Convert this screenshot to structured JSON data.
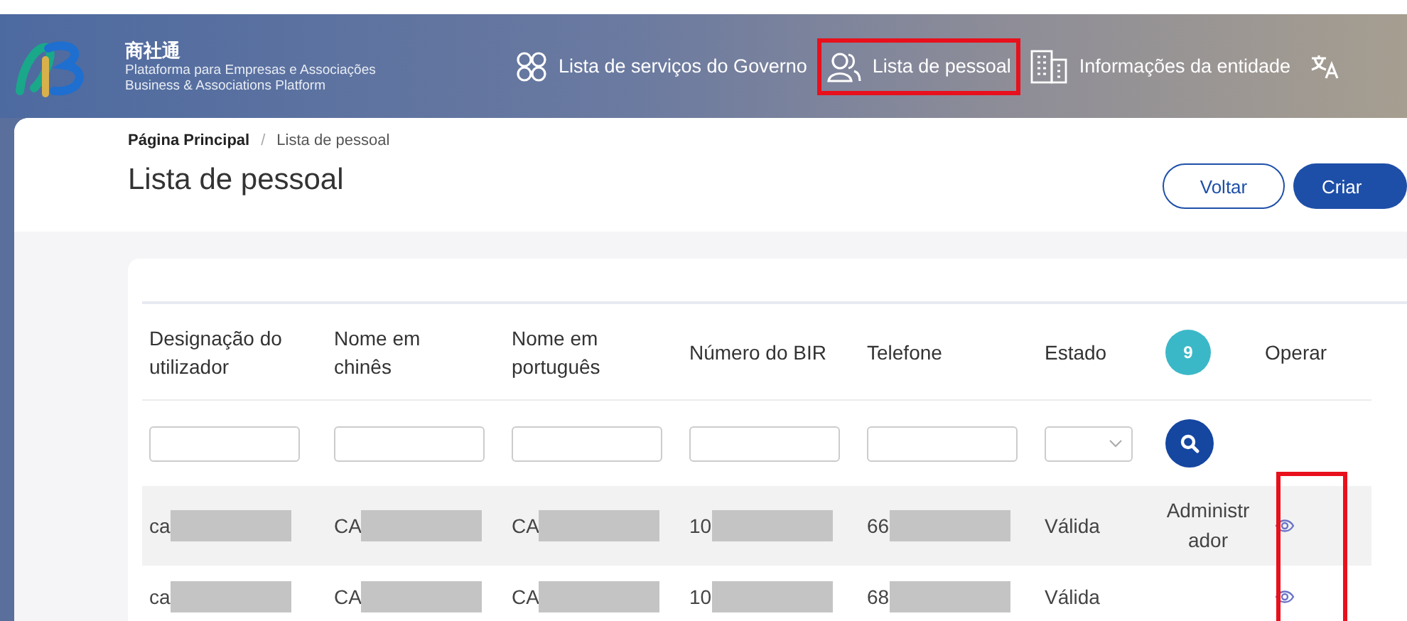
{
  "brand": {
    "name": "商社通",
    "subtitle_pt": "Plataforma para Empresas e Associações",
    "subtitle_en": "Business & Associations Platform"
  },
  "nav": [
    {
      "kind": "services",
      "label": "Lista de serviços do Governo",
      "highlighted": false
    },
    {
      "kind": "people",
      "label": "Lista de pessoal",
      "highlighted": true
    },
    {
      "kind": "building",
      "label": "Informações da entidade",
      "highlighted": false
    },
    {
      "kind": "language",
      "highlighted": false
    }
  ],
  "breadcrumb": [
    {
      "label": "Página Principal",
      "current": false
    },
    {
      "label": "Lista de pessoal",
      "current": true
    }
  ],
  "breadcrumb_separator": "/",
  "page_title": "Lista de pessoal",
  "buttons": [
    {
      "kind": "outline",
      "label": "Voltar"
    },
    {
      "kind": "primary",
      "label": "Criar"
    }
  ],
  "table": {
    "columns": [
      {
        "kind": "text",
        "label": "Designação do utilizador"
      },
      {
        "kind": "text",
        "label": "Nome em chinês"
      },
      {
        "kind": "text",
        "label": "Nome em português"
      },
      {
        "kind": "text",
        "label": "Número do BIR"
      },
      {
        "kind": "text",
        "label": "Telefone"
      },
      {
        "kind": "text",
        "label": "Estado"
      },
      {
        "kind": "count",
        "label": "9"
      },
      {
        "kind": "action",
        "label": "Operar"
      }
    ],
    "filters": [
      {
        "kind": "input"
      },
      {
        "kind": "input"
      },
      {
        "kind": "input"
      },
      {
        "kind": "input"
      },
      {
        "kind": "input"
      },
      {
        "kind": "select"
      },
      {
        "kind": "search"
      },
      {
        "kind": "none"
      }
    ],
    "action_highlighted": true,
    "rows": [
      {
        "cells": [
          {
            "text": "ca",
            "redacted": true
          },
          {
            "text": "CA",
            "redacted": true
          },
          {
            "text": "CA",
            "redacted": true
          },
          {
            "text": "10",
            "redacted": true
          },
          {
            "text": "66",
            "redacted": true
          },
          {
            "text": "Válida",
            "redacted": false
          },
          {
            "text": "Administrador",
            "redacted": false
          }
        ]
      },
      {
        "cells": [
          {
            "text": "ca",
            "redacted": true
          },
          {
            "text": "CA",
            "redacted": true
          },
          {
            "text": "CA",
            "redacted": true
          },
          {
            "text": "10",
            "redacted": true
          },
          {
            "text": "68",
            "redacted": true
          },
          {
            "text": "Válida",
            "redacted": false
          },
          {
            "redacted": false
          }
        ]
      }
    ]
  }
}
